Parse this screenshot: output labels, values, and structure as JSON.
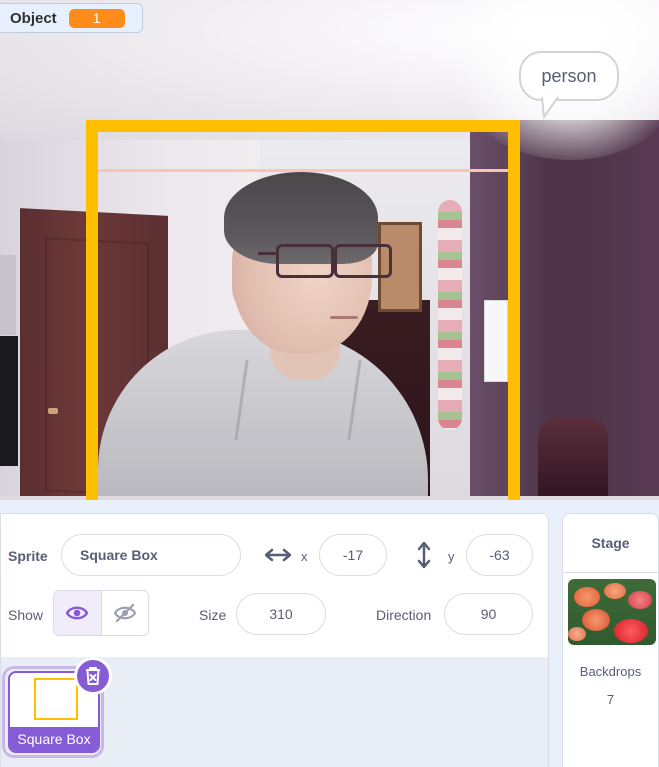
{
  "monitor": {
    "label": "Object",
    "value": "1"
  },
  "stage": {
    "speech_bubble": "person"
  },
  "sprite_info": {
    "sprite_label": "Sprite",
    "sprite_name": "Square Box",
    "x_label": "x",
    "x_value": "-17",
    "y_label": "y",
    "y_value": "-63",
    "show_label": "Show",
    "size_label": "Size",
    "size_value": "310",
    "direction_label": "Direction",
    "direction_value": "90"
  },
  "sprite_list": [
    {
      "name": "Square Box"
    }
  ],
  "stage_selector": {
    "title": "Stage",
    "backdrops_label": "Backdrops",
    "backdrops_count": "7"
  },
  "colors": {
    "accent_purple": "#855cd6",
    "variable_orange": "#ff8c1a",
    "bbox_yellow": "#ffbf00",
    "text_gray": "#575e75"
  },
  "icons": [
    "x-arrow-icon",
    "y-arrow-icon",
    "show-eye-icon",
    "hide-eye-icon",
    "trash-icon"
  ]
}
